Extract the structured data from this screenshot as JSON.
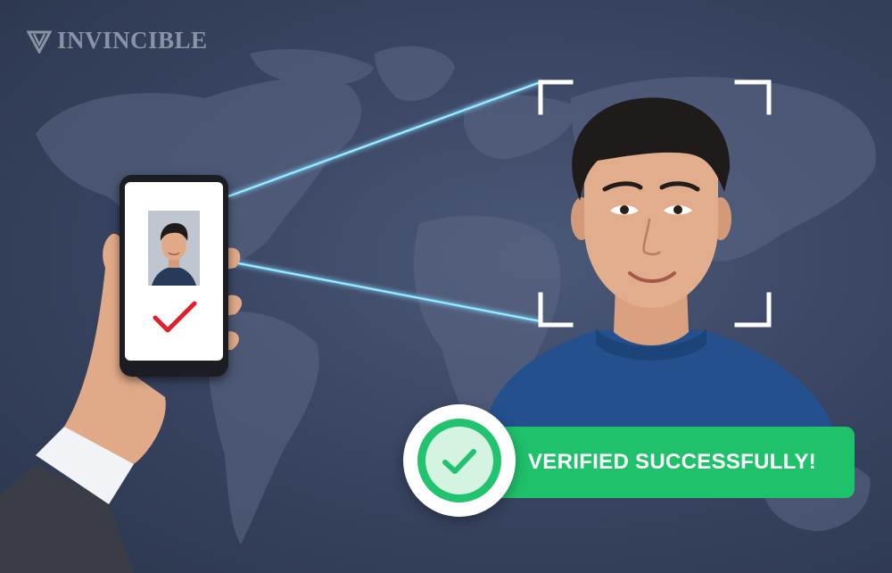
{
  "brand": {
    "name": "INVINCIBLE",
    "logo_icon": "invincible-logo-icon"
  },
  "status": {
    "message": "VERIFIED SUCCESSFULLY!",
    "icon": "check-circle-icon"
  },
  "colors": {
    "background": "#3a4663",
    "beam": "#4fc8ff",
    "success": "#1fc16b",
    "check_red": "#e0202a",
    "frame": "#ffffff"
  }
}
